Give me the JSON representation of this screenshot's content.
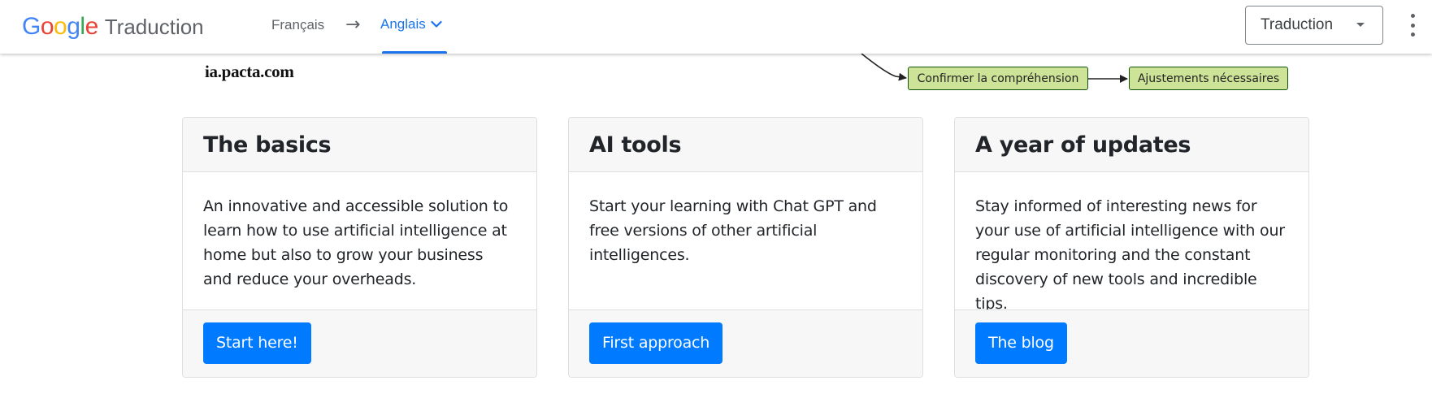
{
  "translate_bar": {
    "logo_letters": [
      "G",
      "o",
      "o",
      "g",
      "l",
      "e"
    ],
    "product": "Traduction",
    "source_language": "Français",
    "arrow": "→",
    "target_language": "Anglais",
    "view_select": "Traduction",
    "colors": {
      "accent": "#1a73e8",
      "google_blue": "#4285F4",
      "google_red": "#EA4335",
      "google_yellow": "#FBBC05",
      "google_green": "#34A853"
    }
  },
  "site": {
    "brand": "ia.pacta.com"
  },
  "flowchart": {
    "nodes": [
      "Confirmer la compréhension",
      "Ajustements nécessaires"
    ],
    "node_fill": "#cde498",
    "node_border": "#13540c"
  },
  "cards": [
    {
      "title": "The basics",
      "body": "An innovative and accessible solution to learn how to use artificial intelligence at home but also to grow your business and reduce your overheads.",
      "button": "Start here!"
    },
    {
      "title": "AI tools",
      "body": "Start your learning with Chat GPT and free versions of other artificial intelligences.",
      "button": "First approach"
    },
    {
      "title": "A year of updates",
      "body": "Stay informed of interesting news for your use of artificial intelligence with our regular monitoring and the constant discovery of new tools and incredible tips.",
      "button": "The blog"
    }
  ],
  "button_color": "#007bff"
}
